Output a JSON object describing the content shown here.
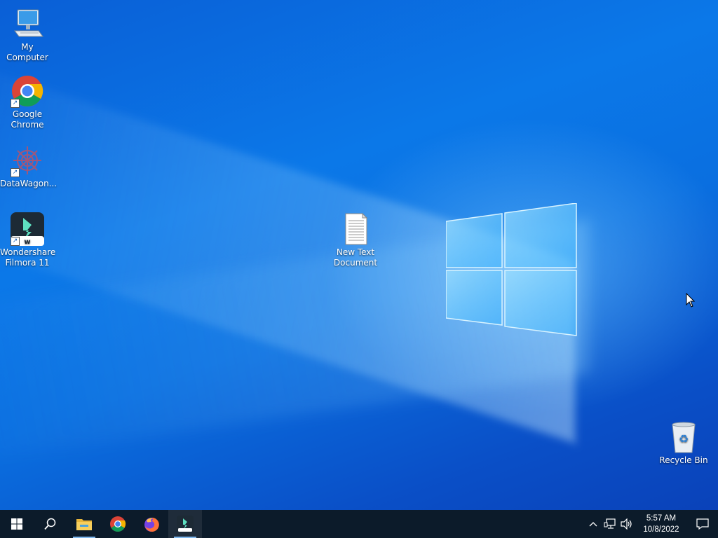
{
  "desktop": {
    "icons": [
      {
        "label": "My Computer"
      },
      {
        "label": "Google Chrome"
      },
      {
        "label": "DataWagon..."
      },
      {
        "label": "Wondershare Filmora 11"
      },
      {
        "label": "New Text Document"
      },
      {
        "label": "Recycle Bin"
      }
    ]
  },
  "taskbar": {
    "pinned": [
      "start-icon",
      "search-icon",
      "file-explorer-icon",
      "chrome-icon",
      "firefox-icon",
      "filmora-icon"
    ],
    "clock": {
      "time": "5:57 AM",
      "date": "10/8/2022"
    }
  },
  "colors": {
    "taskbar": "#0c1b2a",
    "accent": "#0b78e8"
  }
}
